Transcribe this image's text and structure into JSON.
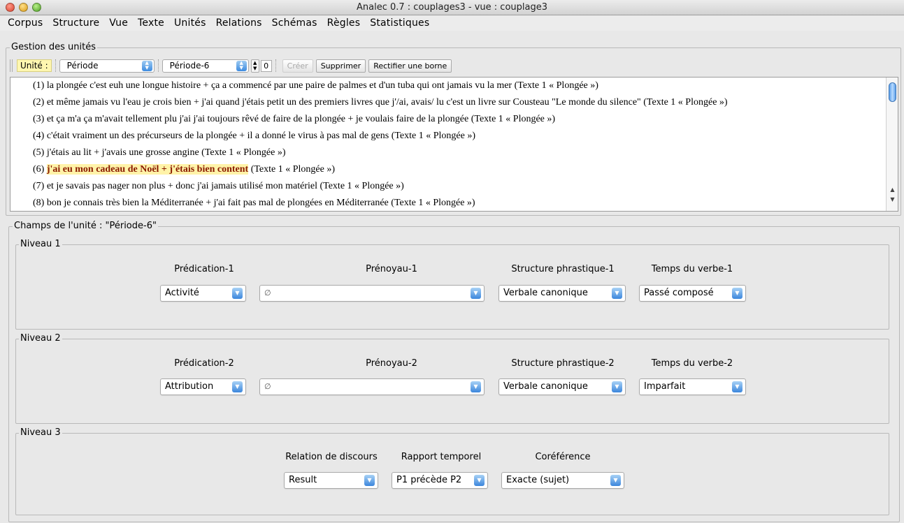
{
  "window": {
    "title": "Analec 0.7 : couplages3 - vue : couplage3"
  },
  "menu": [
    "Corpus",
    "Structure",
    "Vue",
    "Texte",
    "Unités",
    "Relations",
    "Schémas",
    "Règles",
    "Statistiques"
  ],
  "units_group": {
    "title": "Gestion des unités",
    "unit_label": "Unité :",
    "type_select": "Période",
    "instance_select": "Période-6",
    "count": "0",
    "create_label": "Créer",
    "delete_label": "Supprimer",
    "fix_label": "Rectifier une borne"
  },
  "text_lines": [
    {
      "num": "(1)",
      "pre": " la plongée c'est euh une longue histoire + ça a commencé par une paire de palmes et d'un tuba qui ont jamais vu la mer (Texte 1 « Plongée »)",
      "hl": "",
      "post": ""
    },
    {
      "num": "(2)",
      "pre": " et même jamais vu l'eau je crois bien + j'ai quand j'étais petit un des premiers livres que j'/ai, avais/ lu c'est un livre sur Cousteau \"Le monde du silence\" (Texte 1 « Plongée »)",
      "hl": "",
      "post": ""
    },
    {
      "num": "(3)",
      "pre": " et ça m'a ça m'avait tellement plu j'ai j'ai toujours rêvé de faire de la plongée + je voulais faire de la plongée (Texte 1 « Plongée »)",
      "hl": "",
      "post": ""
    },
    {
      "num": "(4)",
      "pre": " c'était vraiment un des précurseurs de la plongée + il a donné le virus à pas mal de gens (Texte 1 « Plongée »)",
      "hl": "",
      "post": ""
    },
    {
      "num": "(5)",
      "pre": " j'étais au lit + j'avais une grosse angine (Texte 1 « Plongée »)",
      "hl": "",
      "post": ""
    },
    {
      "num": "(6)",
      "pre": " ",
      "hl": "j'ai eu mon cadeau de Noël + j'étais bien content",
      "post": " (Texte 1 « Plongée »)"
    },
    {
      "num": "(7)",
      "pre": " et je savais pas nager non plus + donc j'ai jamais utilisé mon matériel (Texte 1 « Plongée »)",
      "hl": "",
      "post": ""
    },
    {
      "num": "(8)",
      "pre": " bon je connais très bien la Méditerranée + j'ai fait pas mal de plongées en Méditerranée (Texte 1 « Plongée »)",
      "hl": "",
      "post": ""
    }
  ],
  "fields_group": {
    "title": "Champs de l'unité :  \"Période-6\"",
    "niveau1": {
      "title": "Niveau 1",
      "predication": {
        "label": "Prédication-1",
        "value": "Activité"
      },
      "prenoyau": {
        "label": "Prénoyau-1",
        "value": "∅"
      },
      "structure": {
        "label": "Structure phrastique-1",
        "value": "Verbale canonique"
      },
      "temps": {
        "label": "Temps du verbe-1",
        "value": "Passé composé"
      }
    },
    "niveau2": {
      "title": "Niveau 2",
      "predication": {
        "label": "Prédication-2",
        "value": "Attribution"
      },
      "prenoyau": {
        "label": "Prénoyau-2",
        "value": "∅"
      },
      "structure": {
        "label": "Structure phrastique-2",
        "value": "Verbale canonique"
      },
      "temps": {
        "label": "Temps du verbe-2",
        "value": "Imparfait"
      }
    },
    "niveau3": {
      "title": "Niveau 3",
      "relation": {
        "label": "Relation de discours",
        "value": "Result"
      },
      "rapport": {
        "label": "Rapport temporel",
        "value": "P1 précède P2"
      },
      "coref": {
        "label": "Coréférence",
        "value": "Exacte (sujet)"
      }
    }
  },
  "colors": {
    "highlight_bg": "#fff3a8",
    "highlight_text": "#8a1a00",
    "unit_label_bg": "#fff7b0",
    "select_arrow": "#3b86dc"
  }
}
